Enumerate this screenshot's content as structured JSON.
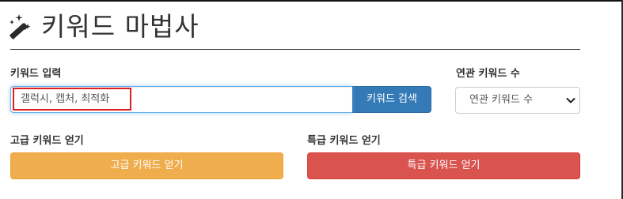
{
  "header": {
    "title": "키워드 마법사",
    "icon": "magic-wand-icon"
  },
  "keyword_section": {
    "label": "키워드 입력",
    "input_value": "갤럭시, 캡처, 최적화",
    "search_button": "키워드 검색"
  },
  "related_section": {
    "label": "연관 키워드 수",
    "select_value": "연관 키워드 수"
  },
  "advanced_section": {
    "label": "고급 키워드 얻기",
    "button": "고급 키워드 얻기"
  },
  "premium_section": {
    "label": "특급 키워드 얻기",
    "button": "특급 키워드 얻기"
  },
  "colors": {
    "primary": "#337ab7",
    "warning": "#f0ad4e",
    "danger": "#d9534f",
    "highlight": "#e02020"
  }
}
